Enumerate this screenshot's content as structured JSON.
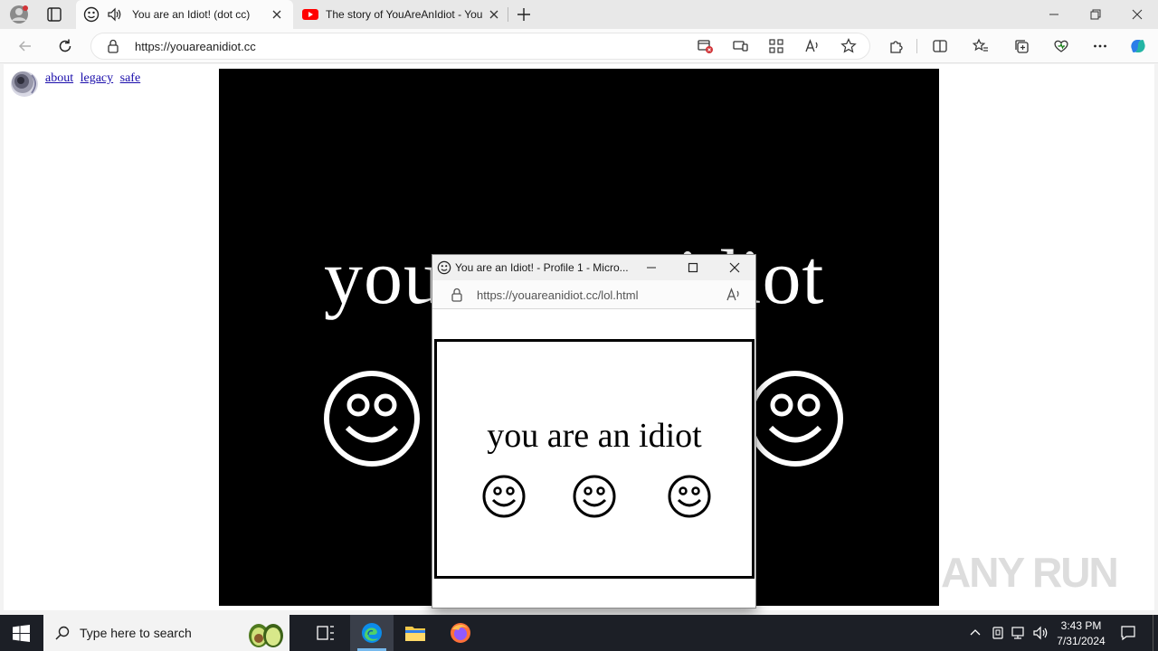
{
  "browser": {
    "tabs": [
      {
        "title": "You are an Idiot! (dot cc)",
        "active": true
      },
      {
        "title": "The story of YouAreAnIdiot - You",
        "active": false
      }
    ],
    "url": "https://youareanidiot.cc"
  },
  "page": {
    "links": [
      "about",
      "legacy",
      "safe"
    ],
    "stage_text": "you are an idiot"
  },
  "popup": {
    "title": "You are an Idiot! - Profile 1 - Micro...",
    "url": "https://youareanidiot.cc/lol.html",
    "text": "you are an idiot"
  },
  "taskbar": {
    "search_placeholder": "Type here to search",
    "time": "3:43 PM",
    "date": "7/31/2024"
  },
  "watermark": "ANY RUN",
  "colors": {
    "accent": "#0067c0",
    "stage": "#000000",
    "taskbar": "#1c1f26"
  }
}
